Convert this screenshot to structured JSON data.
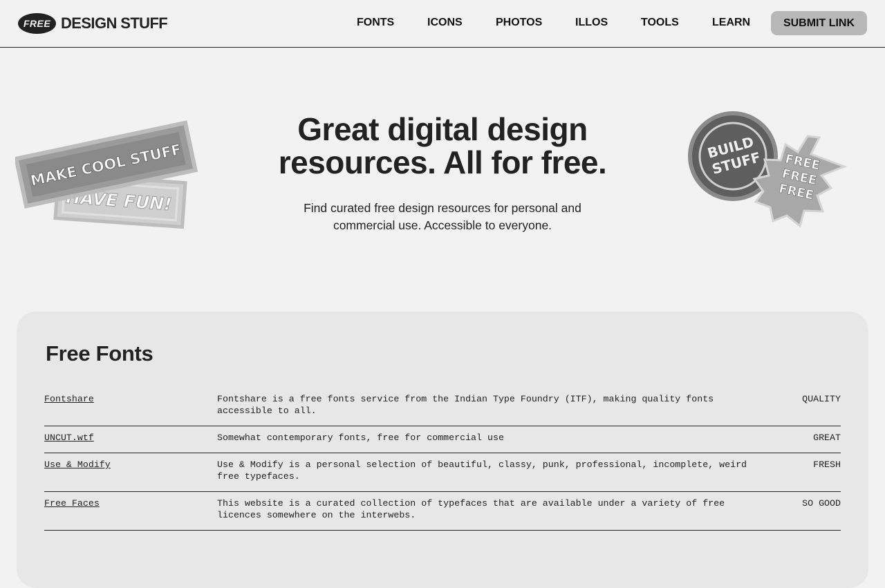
{
  "header": {
    "logo_badge": "FREE",
    "logo_text": "DESIGN STUFF",
    "nav": [
      "FONTS",
      "ICONS",
      "PHOTOS",
      "ILLOS",
      "TOOLS",
      "LEARN"
    ],
    "submit_label": "SUBMIT LINK"
  },
  "hero": {
    "title_line1": "Great digital design",
    "title_line2": "resources. All for free.",
    "subtitle_line1": "Find curated free design resources for personal and",
    "subtitle_line2": "commercial use. Accessible to everyone.",
    "sticker_left_top": "MAKE COOL STUFF",
    "sticker_left_bottom": "HAVE FUN!",
    "sticker_right_circle_line1": "BUILD",
    "sticker_right_circle_line2": "STUFF",
    "sticker_right_star": [
      "FREE",
      "FREE",
      "FREE"
    ]
  },
  "section": {
    "title": "Free Fonts",
    "rows": [
      {
        "name": "Fontshare",
        "desc": "Fontshare is a free fonts service from the Indian Type Foundry (ITF), making quality fonts accessible to all.",
        "tag": "QUALITY"
      },
      {
        "name": "UNCUT.wtf",
        "desc": "Somewhat contemporary fonts, free for commercial use",
        "tag": "GREAT"
      },
      {
        "name": "Use & Modify",
        "desc": "Use & Modify is a personal selection of beautiful, classy, punk, professional, incomplete, weird free typefaces.",
        "tag": "FRESH"
      },
      {
        "name": "Free Faces",
        "desc": "This website is a curated collection of typefaces that are available under a variety of free licences somewhere on the interwebs.",
        "tag": "SO GOOD"
      }
    ]
  }
}
